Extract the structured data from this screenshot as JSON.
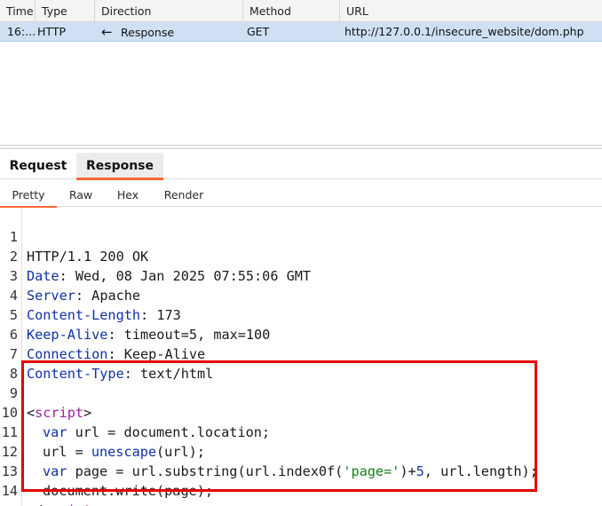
{
  "history_table": {
    "columns": [
      "Time",
      "Type",
      "Direction",
      "Method",
      "URL"
    ],
    "rows": [
      {
        "time": "16:...",
        "type": "HTTP",
        "direction_icon": "left-arrow-icon",
        "direction": "Response",
        "method": "GET",
        "url": "http://127.0.0.1/insecure_website/dom.php"
      }
    ]
  },
  "message_tabs": [
    "Request",
    "Response"
  ],
  "message_tabs_active": "Response",
  "view_tabs": [
    "Pretty",
    "Raw",
    "Hex",
    "Render"
  ],
  "view_tabs_active": "Pretty",
  "response": {
    "line_numbers": [
      "1",
      "2",
      "3",
      "4",
      "5",
      "6",
      "7",
      "8",
      "9",
      "10",
      "11",
      "12",
      "13",
      "14"
    ],
    "status_line": "HTTP/1.1 200 OK",
    "headers": [
      {
        "name": "Date",
        "value": "Wed, 08 Jan 2025 07:55:06 GMT"
      },
      {
        "name": "Server",
        "value": "Apache"
      },
      {
        "name": "Content-Length",
        "value": "173"
      },
      {
        "name": "Keep-Alive",
        "value": "timeout=5, max=100"
      },
      {
        "name": "Connection",
        "value": "Keep-Alive"
      },
      {
        "name": "Content-Type",
        "value": "text/html"
      }
    ],
    "header_separator": ": ",
    "body": {
      "open_lt": "<",
      "tag_name": "script",
      "open_gt": ">",
      "close_lt": "</",
      "line10": {
        "kw": "var",
        "rest": " url = document.location;"
      },
      "line11": {
        "a": "url = ",
        "fn": "unescape",
        "b": "(url);"
      },
      "line12": {
        "kw": "var",
        "a": " page = url.substring(url.index0f(",
        "str": "'page='",
        "b": ")+",
        "num": "5",
        "c": ", url.length);"
      },
      "line13": {
        "a": "document.write(page);"
      }
    }
  },
  "colors": {
    "selected_row": "#cfe0f5",
    "tab_accent": "#ff6633",
    "highlight_border": "#e60000",
    "header_name": "#1030a8",
    "tag": "#a020a0",
    "string": "#1a7a1a"
  }
}
